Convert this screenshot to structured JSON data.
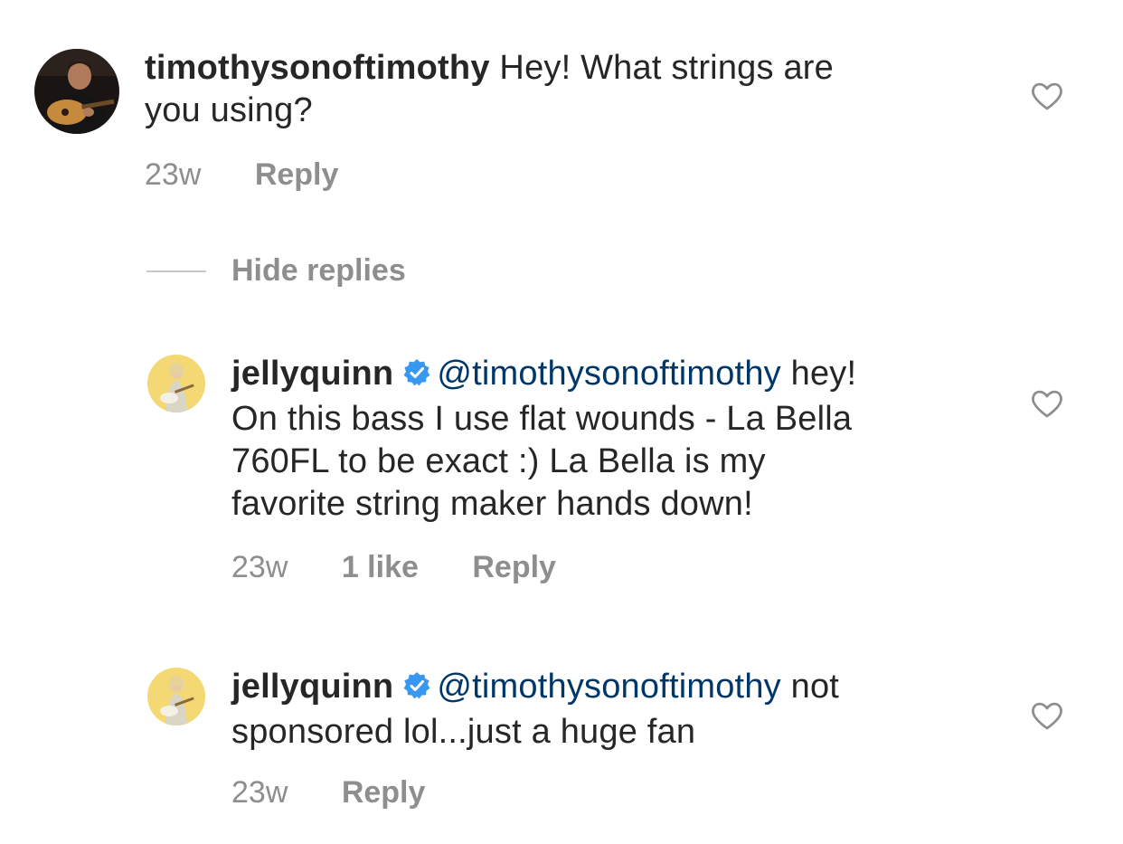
{
  "comments": [
    {
      "username": "timothysonoftimothy",
      "verified": false,
      "mention": "",
      "text": "Hey! What strings are you using?",
      "line1": "Hey! What strings are",
      "line2": "you using?",
      "time": "23w",
      "likes": "",
      "reply_label": "Reply",
      "avatar_icon": "guitarist-avatar"
    },
    {
      "username": "jellyquinn",
      "verified": true,
      "mention": "@timothysonoftimothy",
      "line1_tail": "hey!",
      "line2": "On this bass I use flat wounds - La Bella",
      "line3": "760FL to be exact :) La Bella is my",
      "line4": "favorite string maker hands down!",
      "time": "23w",
      "likes": "1 like",
      "reply_label": "Reply",
      "avatar_icon": "bassist-avatar"
    },
    {
      "username": "jellyquinn",
      "verified": true,
      "mention": "@timothysonoftimothy",
      "line1_tail": "not",
      "line2": "sponsored lol...just a huge fan",
      "time": "23w",
      "likes": "",
      "reply_label": "Reply",
      "avatar_icon": "bassist-avatar"
    }
  ],
  "hide_replies_label": "Hide replies",
  "colors": {
    "mention": "#00376b",
    "verified": "#3897f0",
    "meta": "#8e8e8e"
  }
}
